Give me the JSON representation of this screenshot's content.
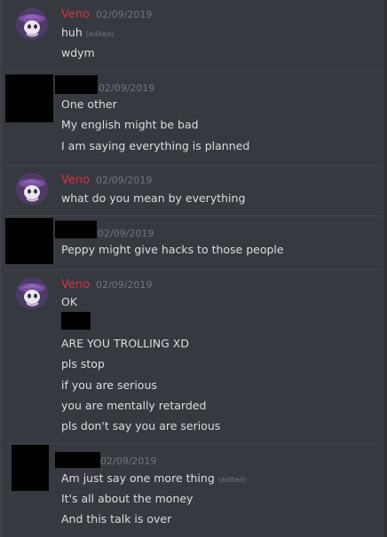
{
  "colors": {
    "background": "#36393f",
    "username": "#d8334a",
    "text": "#dcddde",
    "timestamp": "#72767d"
  },
  "groups": [
    {
      "author": "Veno",
      "timestamp": "02/09/2019",
      "messages": [
        {
          "text": "huh",
          "edited": "(edited)"
        },
        {
          "text": "wdym"
        }
      ]
    },
    {
      "author": "",
      "timestamp": "02/09/2019",
      "messages": [
        {
          "text": "One other"
        },
        {
          "text": "My english might be bad"
        },
        {
          "text": "I am saying everything is planned"
        }
      ]
    },
    {
      "author": "Veno",
      "timestamp": "02/09/2019",
      "messages": [
        {
          "text": "what do you mean by everything"
        }
      ]
    },
    {
      "author": "",
      "timestamp": "02/09/2019",
      "messages": [
        {
          "text": "Peppy might give hacks to those people"
        }
      ]
    },
    {
      "author": "Veno",
      "timestamp": "02/09/2019",
      "messages": [
        {
          "text": "OK"
        },
        {
          "text": "ARE YOU TROLLING XD"
        },
        {
          "text": "pls stop"
        },
        {
          "text": "if you are serious"
        },
        {
          "text": "you are mentally retarded"
        },
        {
          "text": "pls don't say you are serious"
        }
      ]
    },
    {
      "author": "",
      "timestamp": "02/09/2019",
      "messages": [
        {
          "text": "Am just say one more thing",
          "edited": "(edited)"
        },
        {
          "text": "It's all about the money"
        },
        {
          "text": "And this talk is over"
        }
      ]
    }
  ]
}
